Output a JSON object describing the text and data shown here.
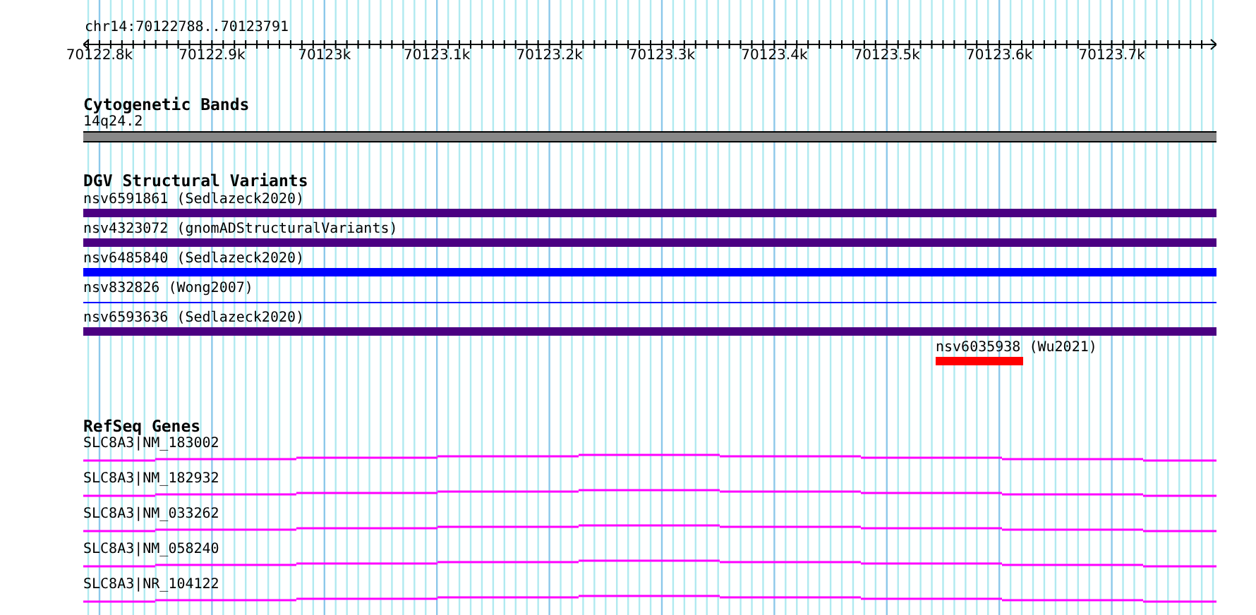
{
  "ruler": {
    "position": "chr14:70122788..70123791",
    "tick_labels": [
      "70122.8k",
      "70122.9k",
      "70123k",
      "70123.1k",
      "70123.2k",
      "70123.3k",
      "70123.4k",
      "70123.5k",
      "70123.6k",
      "70123.7k"
    ]
  },
  "cytogenetic_bands": {
    "title": "Cytogenetic Bands",
    "band": "14q24.2"
  },
  "dgv_structural_variants": {
    "title": "DGV Structural Variants",
    "items": [
      {
        "id_label": "nsv6591861",
        "source": "(Sedlazeck2020)",
        "kind": "bar",
        "color": "#4b0082"
      },
      {
        "id_label": "nsv4323072",
        "source": "(gnomADStructuralVariants)",
        "kind": "bar",
        "color": "#4b0082"
      },
      {
        "id_label": "nsv6485840",
        "source": "(Sedlazeck2020)",
        "kind": "bar",
        "color": "#0000ff"
      },
      {
        "id_label": "nsv832826",
        "source": "(Wong2007)",
        "kind": "line",
        "color": "#0000ff"
      },
      {
        "id_label": "nsv6593636",
        "source": "(Sedlazeck2020)",
        "kind": "bar",
        "color": "#4b0082"
      },
      {
        "id_label": "nsv6035938",
        "source": "(Wu2021)",
        "kind": "short",
        "color": "#ff0000"
      }
    ]
  },
  "refseq_genes": {
    "title": "RefSeq Genes",
    "items": [
      {
        "label": "SLC8A3|NM_183002"
      },
      {
        "label": "SLC8A3|NM_182932"
      },
      {
        "label": "SLC8A3|NM_033262"
      },
      {
        "label": "SLC8A3|NM_058240"
      },
      {
        "label": "SLC8A3|NR_104122"
      }
    ]
  }
}
